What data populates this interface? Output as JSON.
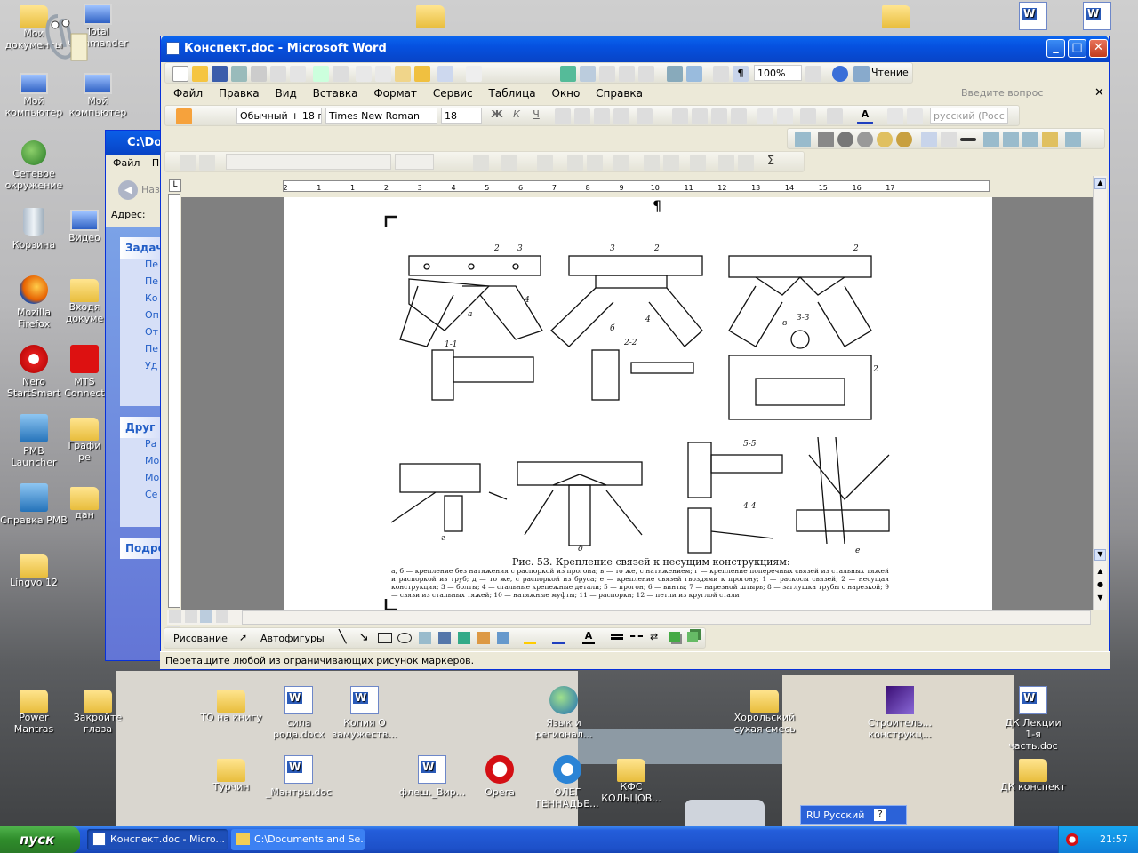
{
  "desktop": {
    "icons": [
      {
        "label": "Мои документы",
        "x": 0
      },
      {
        "label": "Total Commander"
      },
      {
        "label": "Мой компьютер"
      },
      {
        "label": "Мой компьютер"
      },
      {
        "label": "Сетевое окружение"
      },
      {
        "label": "Корзина"
      },
      {
        "label": "Видео"
      },
      {
        "label": "Mozilla Firefox"
      },
      {
        "label": "Входя докуме"
      },
      {
        "label": "Nero StartSmart"
      },
      {
        "label": "MTS Connect"
      },
      {
        "label": "PMB Launcher"
      },
      {
        "label": "Графи ре"
      },
      {
        "label": "Справка PMB"
      },
      {
        "label": "дан"
      },
      {
        "label": "Lingvo 12"
      },
      {
        "label": "Power Mantras"
      },
      {
        "label": "Закройте глаза"
      },
      {
        "label": "ТО на книгу"
      },
      {
        "label": "сила рода.docx"
      },
      {
        "label": "Копия О замужеств..."
      },
      {
        "label": "Язык и регионал..."
      },
      {
        "label": "Хорольский сухая смесь"
      },
      {
        "label": "Строитель... конструкц..."
      },
      {
        "label": "ДК Лекции 1-я часть.doc"
      },
      {
        "label": "Турчин"
      },
      {
        "label": "_Мантры.doc"
      },
      {
        "label": "флеш._Вир..."
      },
      {
        "label": "Opera"
      },
      {
        "label": "ОЛЕГ ГЕННАДЬЕ..."
      },
      {
        "label": "КФС КОЛЬЦОВ..."
      },
      {
        "label": "ДК конспект"
      }
    ]
  },
  "explorer": {
    "title": "C:\\Doc",
    "menu_file": "Файл",
    "menu_p": "П",
    "back": "Наза",
    "address": "Адрес:",
    "tasks_header": "Задач",
    "tasks": [
      "Пе",
      "Пе",
      "Ко",
      "Оп",
      "От эл",
      "Пе",
      "Уд"
    ],
    "other_header": "Друг",
    "other": [
      "Ра",
      "Мо",
      "Мо",
      "Се"
    ],
    "details_header": "Подро"
  },
  "word": {
    "title": "Конспект.doc - Microsoft Word",
    "zoom": "100%",
    "reading": "Чтение",
    "menu": [
      "Файл",
      "Правка",
      "Вид",
      "Вставка",
      "Формат",
      "Сервис",
      "Таблица",
      "Окно",
      "Справка"
    ],
    "ask": "Введите вопрос",
    "style": "Обычный + 18 г",
    "font": "Times New Roman",
    "size": "18",
    "lang": "русский (Росс",
    "ruler_numbers": [
      "2",
      "1",
      "1",
      "2",
      "3",
      "4",
      "5",
      "6",
      "7",
      "8",
      "9",
      "10",
      "11",
      "12",
      "13",
      "14",
      "15",
      "16",
      "17"
    ],
    "figure_caption": "Рис. 53. Крепление связей к несущим конструкциям:",
    "figure_text": "а, б — крепление без натяжения с распоркой из прогона; в — то же, с натяжением; г — крепление поперечных связей из стальных тяжей и распоркой из труб; д — то же, с распоркой из бруса; е — крепление связей гвоздями к прогону; 1 — раскосы связей; 2 — несущая конструкция; 3 — болты; 4 — стальные крепежные детали; 5 — прогон; 6 — винты; 7 — нарезной штырь; 8 — заглушка трубы с нарезкой; 9 — связи из стальных тяжей; 10 — натяжные муфты; 11 — распорки; 12 — петли из круглой стали",
    "draw_label": "Рисование",
    "autoshapes": "Автофигуры",
    "status": "Перетащите любой из ограничивающих рисунок маркеров."
  },
  "taskbar": {
    "start": "пуск",
    "items": [
      "Конспект.doc - Micro...",
      "C:\\Documents and Se..."
    ],
    "lang": "RU Русский",
    "time": "21:57"
  }
}
